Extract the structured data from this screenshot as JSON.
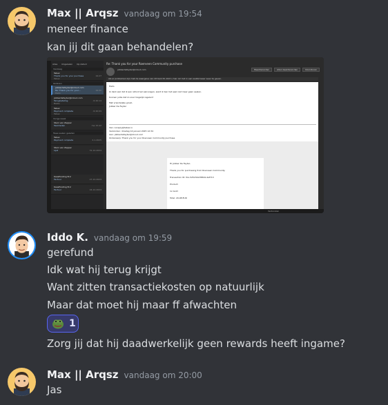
{
  "messages": [
    {
      "author": "Max || Arqsz",
      "timestamp": "vandaag om 19:54",
      "avatar_icon": "cartoon-bearded-man-avatar",
      "lines": [
        "meneer finance",
        "kan jij dit gaan behandelen?"
      ]
    },
    {
      "author": "Iddo K.",
      "timestamp": "vandaag om 19:59",
      "avatar_icon": "cartoon-man-avatar",
      "lines": [
        "gerefund",
        "Idk wat hij terug krijgt",
        "Want zitten transactiekosten op natuurlijk",
        "Maar dat moet hij maar ff afwachten"
      ],
      "reaction": {
        "emoji": "pepe-frog-emoji",
        "count": "1"
      },
      "after_reaction": "Zorg jij dat hij daadwerkelijk geen rewards heeft ingame?"
    },
    {
      "author": "Max || Arqsz",
      "timestamp": "vandaag om 20:00",
      "avatar_icon": "cartoon-bearded-man-avatar",
      "lines": [
        "Jas"
      ]
    }
  ],
  "attachment": {
    "tabs": [
      "Alles",
      "Ongelezen",
      "Op datum"
    ],
    "sections": [
      "Vandaag",
      "Gisteren",
      "Vorige week",
      "Twee weken geleden"
    ],
    "items": [
      {
        "from": "Tebex",
        "subject": "Thank you for your purchase",
        "preview": "Tebex",
        "date": "19:27"
      },
      {
        "from": "jobberdefeyter@icloud.com",
        "subject": "Re: Thank you for your...",
        "preview": "Hallo",
        "date": "19:30"
      },
      {
        "from": "jobberdefeyter@icloud.com",
        "subject": "Terugbetaling",
        "preview": "Beste",
        "date": "di 20:14"
      },
      {
        "from": "Tebex",
        "subject": "Payment complete",
        "preview": "Tebex",
        "date": "di 20:09"
      },
      {
        "from": "Stein van Zapper",
        "subject": "Teamleden",
        "preview": "",
        "date": "ma 15:42"
      },
      {
        "from": "Tebex",
        "subject": "Payment complete",
        "preview": "",
        "date": "2-1-2025"
      },
      {
        "from": "Stein van Zapper",
        "subject": "Lijst",
        "preview": "",
        "date": "31-12-2024"
      },
      {
        "from": "KaasHosting B.V.",
        "subject": "Factuur",
        "preview": "",
        "date": "27-12-2024"
      },
      {
        "from": "KaasHosting B.V.",
        "subject": "Factuur",
        "preview": "",
        "date": "24-12-2024"
      }
    ],
    "subject": "Re: Thank you for your Roerveen Community purchase",
    "from_line": "jobberdefeyter@icloud.com",
    "buttons": [
      "Beantwoorden",
      "Allen beantwoorden",
      "Doorsturen"
    ],
    "warning": "Als er problemen zijn met de weergave van dit bericht, klikt u hier om het in een webbrowser weer te geven.",
    "body_lines": [
      "Hallo",
      "Ik denk wel dat ik een refund wil aanvragen, want ik ben het spel niet meer gaan spelen.",
      "Kunnen jullie dat zo snel mogelijk regelen?",
      "Met vriendelijke groet,",
      "Jobber De Feyter"
    ],
    "quote_lines": [
      "Van: noreply@tebex.io",
      "Verzonden: dinsdag 14 januari 2025 12:34",
      "Aan: jobberdefeyter@icloud.com",
      "Onderwerp: Thank you for your Roerveen Community purchase"
    ],
    "card_lines": [
      "Hi Jobber De Feyter,",
      "Thank you for purchasing from Roerveen Community.",
      "Transaction ID: tbx-525232a78844-4af713",
      "Product:",
      "1x Gold",
      "Total: 29.98 EUR"
    ],
    "status": "Verbonden"
  },
  "colors": {
    "background": "#313338",
    "author": "#f2f3f5",
    "text": "#dbdee1",
    "timestamp": "#949ba4",
    "reaction_bg": "#373a6b",
    "reaction_border": "#5865f2"
  }
}
